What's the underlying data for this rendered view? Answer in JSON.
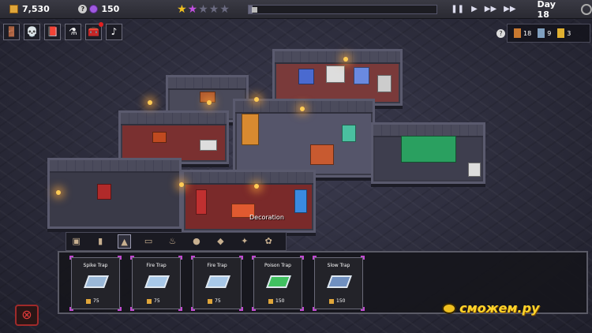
{
  "hud": {
    "gold": "7,530",
    "gems": "150",
    "stars_filled": 2,
    "stars_total": 5,
    "day_label": "Day 18",
    "day_progress": 0.02,
    "controls": [
      "pause",
      "play",
      "fast-forward",
      "faster-forward"
    ]
  },
  "build_tabs": [
    {
      "name": "doors-tab",
      "icon": "door-icon",
      "glyph": "🚪"
    },
    {
      "name": "minions-tab",
      "icon": "skull-icon",
      "glyph": "💀"
    },
    {
      "name": "books-tab",
      "icon": "book-icon",
      "glyph": "📕"
    },
    {
      "name": "potions-tab",
      "icon": "potion-icon",
      "glyph": "⚗"
    },
    {
      "name": "furniture-tab",
      "icon": "chest-icon",
      "glyph": "🧰",
      "alert": true
    },
    {
      "name": "music-tab",
      "icon": "music-icon",
      "glyph": "♪"
    }
  ],
  "population": {
    "help": "?",
    "groups": [
      {
        "icon": "minion-orange-icon",
        "color": "#c87830",
        "count": "18"
      },
      {
        "icon": "minion-blue-icon",
        "color": "#80a0c0",
        "count": "9"
      },
      {
        "icon": "minion-yellow-icon",
        "color": "#e0b030",
        "count": "3"
      }
    ]
  },
  "categories": [
    {
      "name": "category-furniture",
      "icon": "crate-icon",
      "glyph": "▣",
      "active": false
    },
    {
      "name": "category-doors",
      "icon": "door-icon",
      "glyph": "▮",
      "active": false
    },
    {
      "name": "category-traps",
      "icon": "spikes-icon",
      "glyph": "▲",
      "active": true
    },
    {
      "name": "category-floor",
      "icon": "tile-icon",
      "glyph": "▭",
      "active": false
    },
    {
      "name": "category-monsters",
      "icon": "flame-icon",
      "glyph": "♨",
      "active": false
    },
    {
      "name": "category-storage",
      "icon": "barrel-icon",
      "glyph": "●",
      "active": false
    },
    {
      "name": "category-machines",
      "icon": "machine-icon",
      "glyph": "◆",
      "active": false
    },
    {
      "name": "category-lights",
      "icon": "torch-icon",
      "glyph": "✦",
      "active": false
    },
    {
      "name": "category-plants",
      "icon": "plant-icon",
      "glyph": "✿",
      "active": false
    }
  ],
  "traps": [
    {
      "name": "Spike Trap",
      "cost": "75",
      "color": "#9ab8d8"
    },
    {
      "name": "Fire Trap",
      "cost": "75",
      "color": "#a8c8e8"
    },
    {
      "name": "Fire Trap",
      "cost": "75",
      "color": "#a8c8e8"
    },
    {
      "name": "Poison Trap",
      "cost": "150",
      "color": "#40c060"
    },
    {
      "name": "Slow Trap",
      "cost": "150",
      "color": "#7090c0"
    }
  ],
  "scene": {
    "decoration_label": "Decoration"
  },
  "watermark": "сможем.ру"
}
